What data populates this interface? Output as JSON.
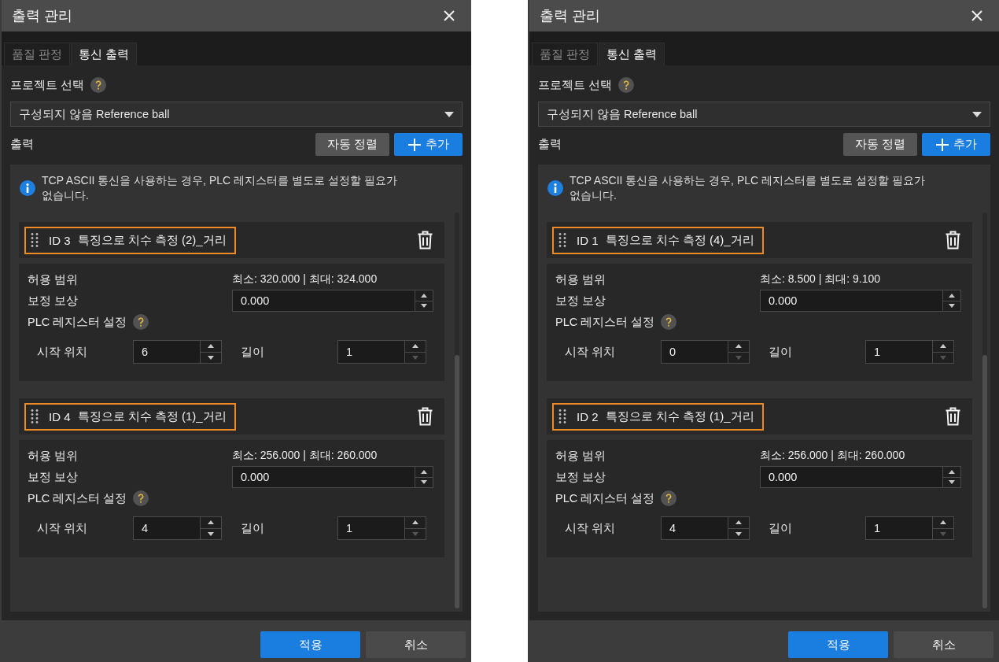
{
  "dialogs": [
    {
      "title": "출력 관리",
      "tabs": [
        {
          "label": "품질 판정",
          "selected": false
        },
        {
          "label": "통신 출력",
          "selected": true
        }
      ],
      "project": {
        "label": "프로젝트 선택",
        "value": "구성되지 않음 Reference ball"
      },
      "output": {
        "label": "출력",
        "buttons": [
          {
            "kind": "secondary",
            "label": "자동 정렬"
          },
          {
            "kind": "add",
            "label": "추가"
          }
        ]
      },
      "info": "TCP ASCII 통신을 사용하는 경우, PLC 레지스터를 별도로 설정할 필요가 없습니다.",
      "items": [
        {
          "id": "ID 3",
          "title": "특징으로 치수 측정 (2)_거리",
          "highlighted": true,
          "tolerance": {
            "label": "허용 범위",
            "value": "최소: 320.000 | 최대: 324.000"
          },
          "offset": {
            "label": "보정 보상",
            "value": "0.000",
            "down_disabled": false
          },
          "plc_label": "PLC 레지스터 설정",
          "start": {
            "label": "시작 위치",
            "value": "6",
            "down_disabled": false
          },
          "length": {
            "label": "길이",
            "value": "1",
            "down_disabled": true
          }
        },
        {
          "id": "ID 4",
          "title": "특징으로 치수 측정 (1)_거리",
          "highlighted": true,
          "tolerance": {
            "label": "허용 범위",
            "value": "최소: 256.000 | 최대: 260.000"
          },
          "offset": {
            "label": "보정 보상",
            "value": "0.000",
            "down_disabled": false
          },
          "plc_label": "PLC 레지스터 설정",
          "start": {
            "label": "시작 위치",
            "value": "4",
            "down_disabled": false
          },
          "length": {
            "label": "길이",
            "value": "1",
            "down_disabled": true
          }
        }
      ],
      "footer_buttons": [
        {
          "kind": "primary",
          "label": "적용"
        },
        {
          "kind": "secondary",
          "label": "취소"
        }
      ]
    },
    {
      "title": "출력 관리",
      "tabs": [
        {
          "label": "품질 판정",
          "selected": false
        },
        {
          "label": "통신 출력",
          "selected": true
        }
      ],
      "project": {
        "label": "프로젝트 선택",
        "value": "구성되지 않음 Reference ball"
      },
      "output": {
        "label": "출력",
        "buttons": [
          {
            "kind": "secondary",
            "label": "자동 정렬"
          },
          {
            "kind": "add",
            "label": "추가"
          }
        ]
      },
      "info": "TCP ASCII 통신을 사용하는 경우, PLC 레지스터를 별도로 설정할 필요가 없습니다.",
      "items": [
        {
          "id": "ID 1",
          "title": "특징으로 치수 측정 (4)_거리",
          "highlighted": true,
          "tolerance": {
            "label": "허용 범위",
            "value": "최소: 8.500 | 최대: 9.100"
          },
          "offset": {
            "label": "보정 보상",
            "value": "0.000",
            "down_disabled": false
          },
          "plc_label": "PLC 레지스터 설정",
          "start": {
            "label": "시작 위치",
            "value": "0",
            "down_disabled": true
          },
          "length": {
            "label": "길이",
            "value": "1",
            "down_disabled": true
          }
        },
        {
          "id": "ID 2",
          "title": "특징으로 치수 측정 (1)_거리",
          "highlighted": true,
          "tolerance": {
            "label": "허용 범위",
            "value": "최소: 256.000 | 최대: 260.000"
          },
          "offset": {
            "label": "보정 보상",
            "value": "0.000",
            "down_disabled": false
          },
          "plc_label": "PLC 레지스터 설정",
          "start": {
            "label": "시작 위치",
            "value": "4",
            "down_disabled": false
          },
          "length": {
            "label": "길이",
            "value": "1",
            "down_disabled": true
          }
        }
      ],
      "footer_buttons": [
        {
          "kind": "primary",
          "label": "적용"
        },
        {
          "kind": "secondary",
          "label": "취소"
        }
      ]
    }
  ]
}
